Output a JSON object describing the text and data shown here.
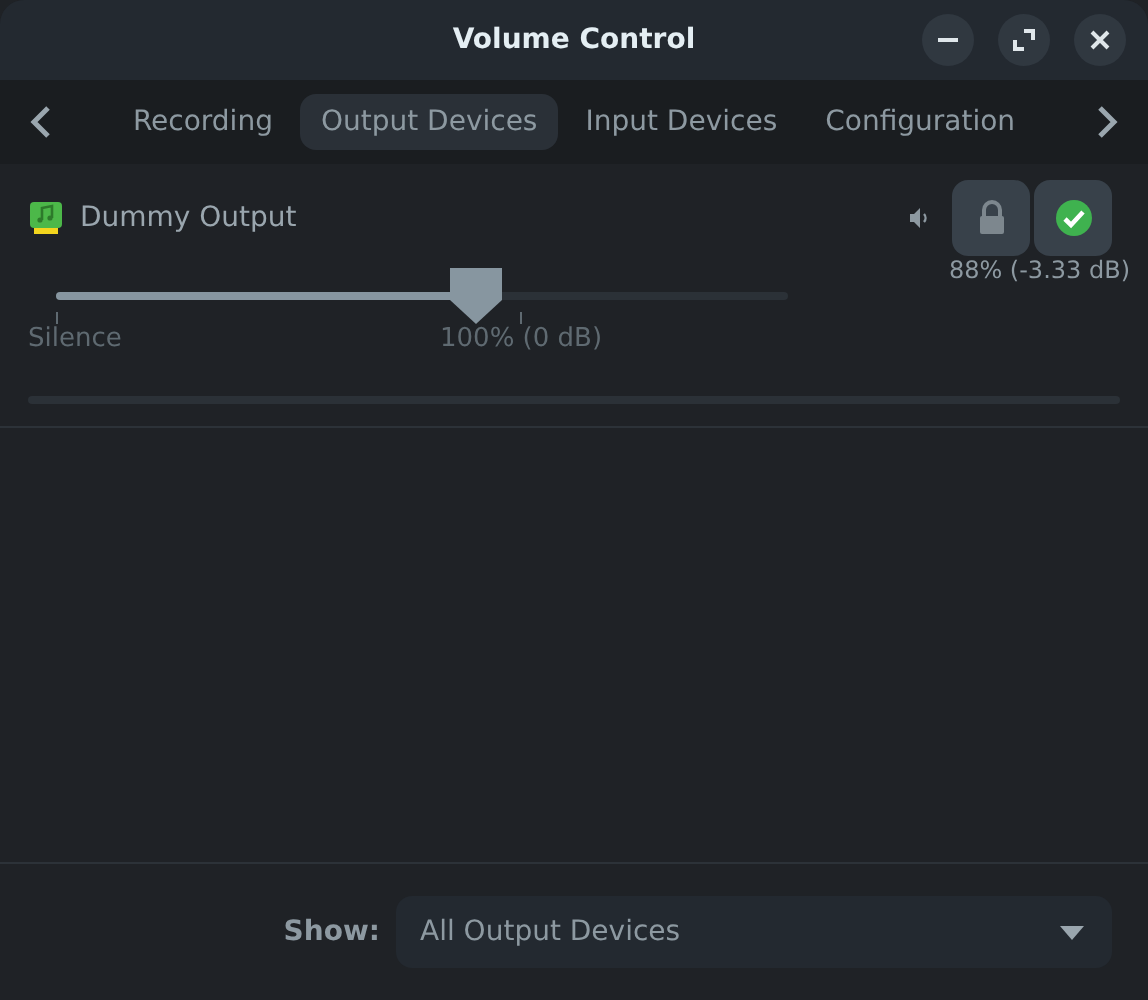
{
  "window": {
    "title": "Volume Control"
  },
  "tabs": [
    {
      "label": "Recording",
      "selected": false
    },
    {
      "label": "Output Devices",
      "selected": true
    },
    {
      "label": "Input Devices",
      "selected": false
    },
    {
      "label": "Configuration",
      "selected": false
    }
  ],
  "device": {
    "name": "Dummy Output",
    "volume": {
      "level": 0.574,
      "reading": "88% (-3.33 dB)"
    },
    "scale_labels": [
      "Silence",
      "100% (0 dB)"
    ]
  },
  "footer": {
    "label": "Show:",
    "value": "All Output Devices"
  }
}
